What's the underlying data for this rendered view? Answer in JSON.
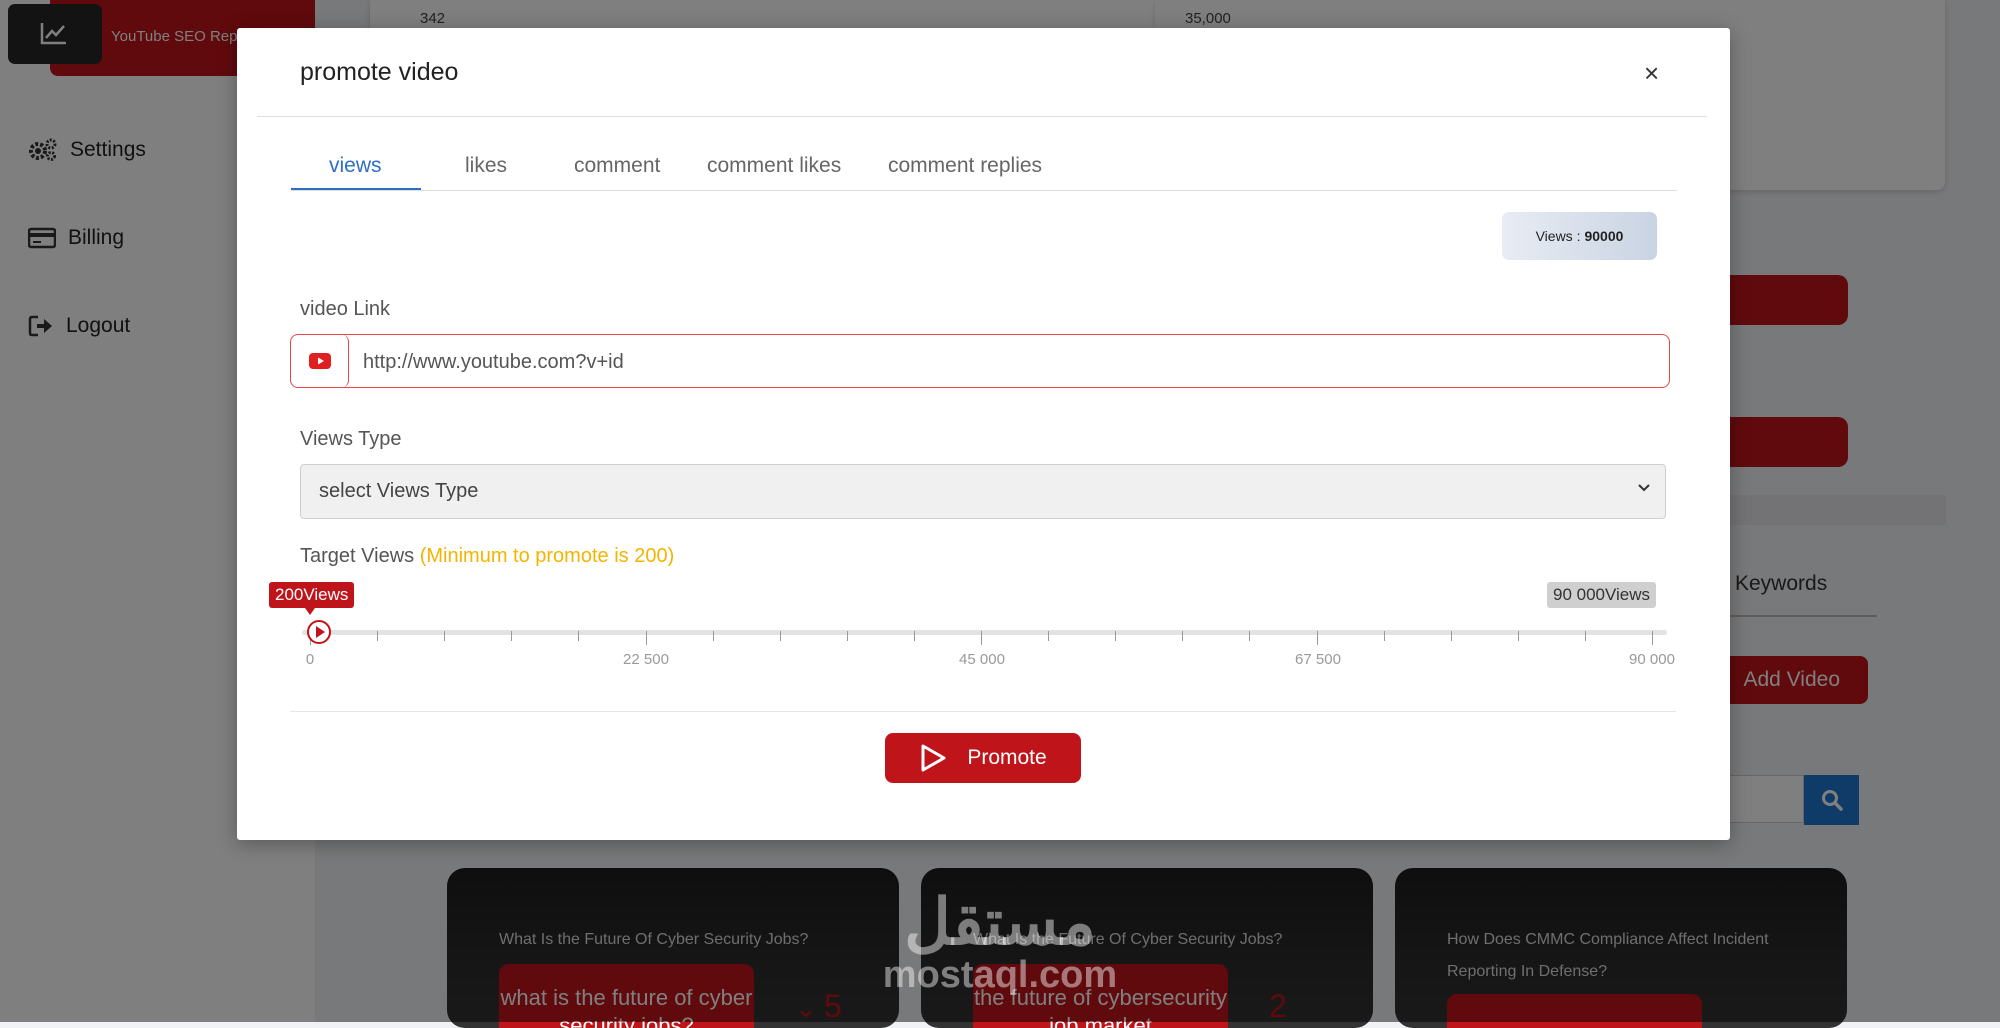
{
  "brand": {
    "title": "YouTube SEO Rep"
  },
  "sidebar": {
    "items": [
      {
        "label": "Settings",
        "icon": "gears-icon"
      },
      {
        "label": "Billing",
        "icon": "credit-card-icon"
      },
      {
        "label": "Logout",
        "icon": "sign-out-icon"
      }
    ]
  },
  "background": {
    "card1_axis_label": "342",
    "card2_axis_label": "35,000",
    "keywords_tab": "Keywords",
    "add_video_button": "Add Video",
    "videos": [
      {
        "title": "What Is the Future Of Cyber Security Jobs?",
        "chip": "what is the future of cyber security jobs?",
        "count": "5"
      },
      {
        "title": "What Is the Future Of Cyber Security Jobs?",
        "chip": "the future of cybersecurity job market",
        "count": "2"
      },
      {
        "title": "How Does CMMC Compliance Affect Incident Reporting In Defense?",
        "chip": "",
        "count": ""
      }
    ]
  },
  "watermark": {
    "arabic": "مستقل",
    "latin": "mostaql.com"
  },
  "modal": {
    "title": "promote video",
    "close": "×",
    "tabs": [
      "views",
      "likes",
      "comment",
      "comment likes",
      "comment replies"
    ],
    "active_tab": "views",
    "badge": {
      "label": "Views :",
      "value": "90000"
    },
    "video_link": {
      "label": "video Link",
      "placeholder": "http://www.youtube.com?v+id"
    },
    "views_type": {
      "label": "Views Type",
      "selected": "select Views Type"
    },
    "target": {
      "label": "Target Views",
      "hint": "(Minimum to promote is 200)",
      "min_pill": "200Views",
      "max_pill": "90 000Views",
      "current_value": 200,
      "range_min": 0,
      "range_max": 90000,
      "tick_labels": [
        "0",
        "22 500",
        "45 000",
        "67 500",
        "90 000"
      ]
    },
    "promote_button": "Promote"
  },
  "colors": {
    "brand_red": "#c0141b",
    "tab_active": "#2f6ec2",
    "hint": "#f4b400",
    "search_blue": "#1f77d0"
  }
}
